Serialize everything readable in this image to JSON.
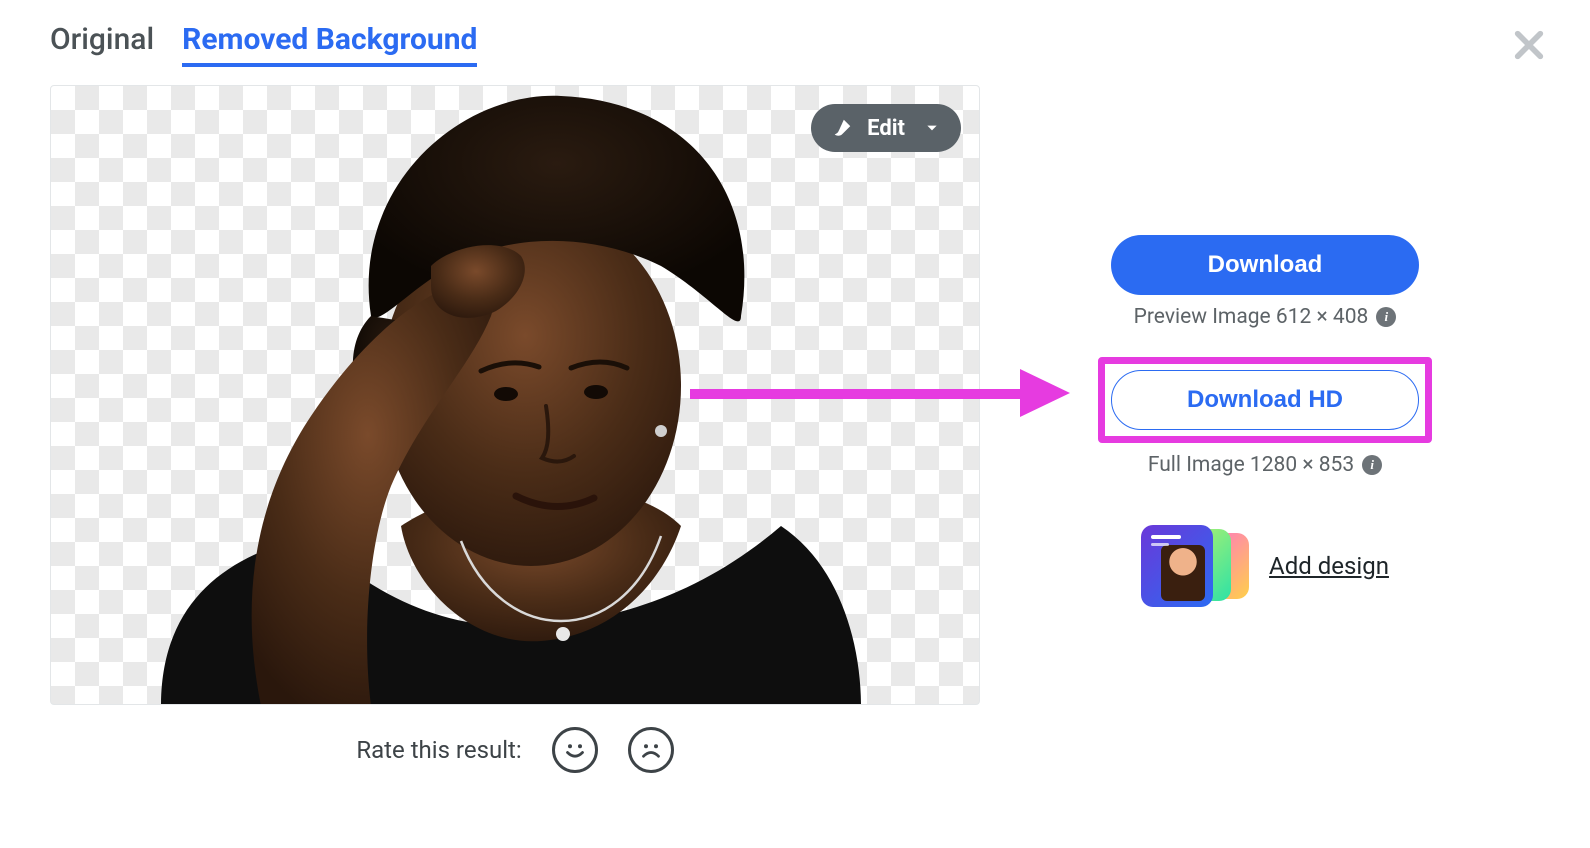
{
  "tabs": {
    "original": "Original",
    "removed_bg": "Removed Background"
  },
  "edit_button": {
    "label": "Edit"
  },
  "rate": {
    "label": "Rate this result:"
  },
  "download": {
    "primary_label": "Download",
    "preview_meta": "Preview Image 612 × 408",
    "hd_label": "Download HD",
    "full_meta": "Full Image 1280 × 853"
  },
  "add_design": {
    "label": "Add design"
  }
}
